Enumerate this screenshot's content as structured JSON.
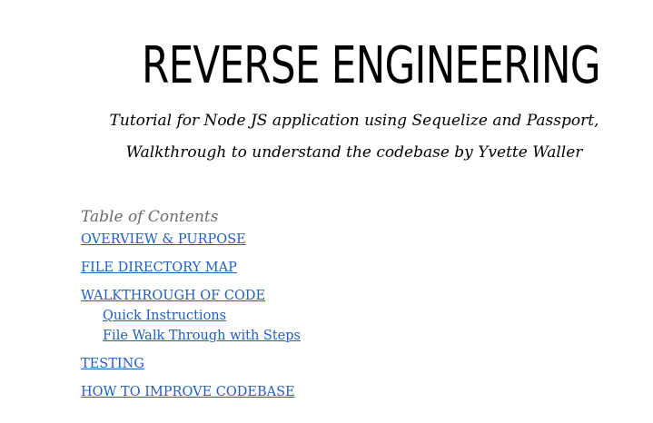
{
  "header": {
    "title": "REVERSE ENGINEERING",
    "subtitle_line1": "Tutorial for Node JS application using Sequelize and Passport,",
    "subtitle_line2": "Walkthrough to understand the codebase by Yvette Waller"
  },
  "toc": {
    "heading": "Table of Contents",
    "items": [
      {
        "label": "OVERVIEW & PURPOSE"
      },
      {
        "label": "FILE DIRECTORY MAP"
      },
      {
        "label": "WALKTHROUGH OF CODE",
        "children": [
          {
            "label": "Quick Instructions"
          },
          {
            "label": "File Walk Through with Steps"
          }
        ]
      },
      {
        "label": "TESTING"
      },
      {
        "label": "HOW TO IMPROVE CODEBASE"
      }
    ]
  },
  "colors": {
    "link": "#1f5fbf",
    "heading_muted": "#6b6b6b",
    "text": "#000000"
  }
}
